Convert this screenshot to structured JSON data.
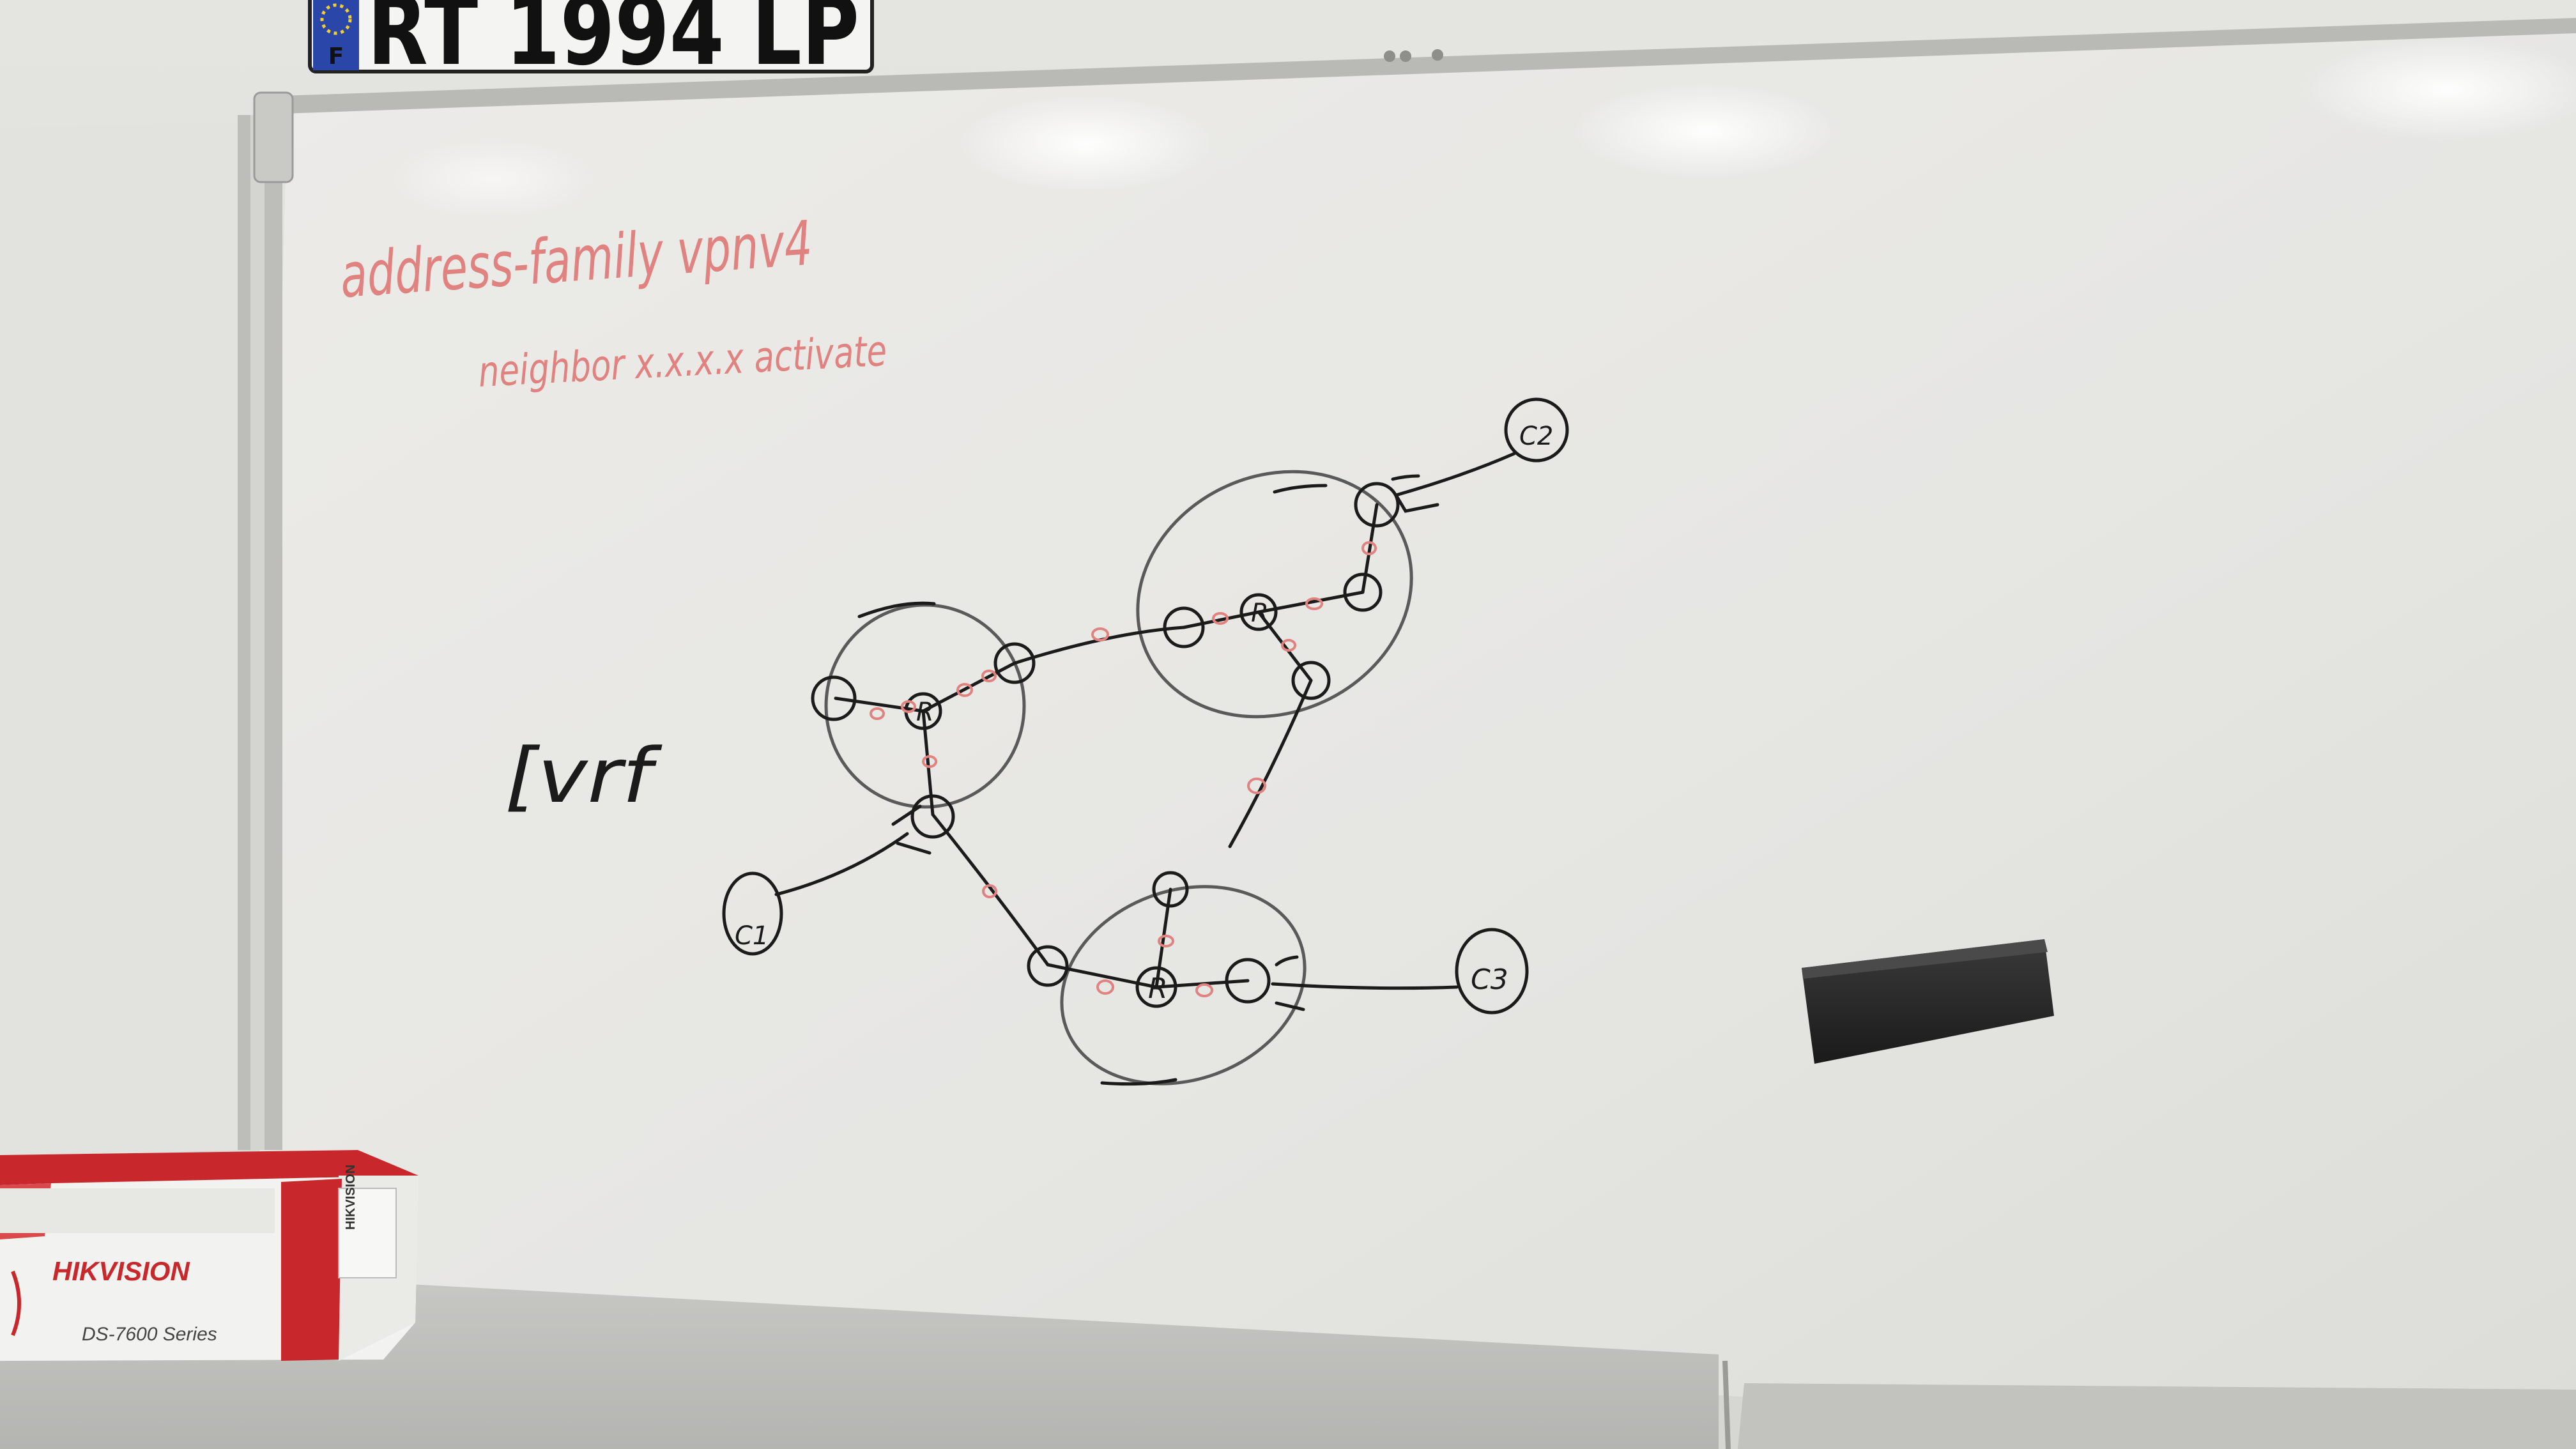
{
  "license_plate": {
    "country_code": "F",
    "text": "RT 1994 LP"
  },
  "whiteboard": {
    "config_line_1": "address-family vpnv4",
    "config_line_2": "neighbor x.x.x.x activate",
    "vrf_label": "[vrf",
    "router_label": "R",
    "ce_labels": [
      "C1",
      "C2",
      "C3"
    ]
  },
  "box": {
    "brand": "HIKVISION",
    "series": "DS-7600 Series",
    "side_brand": "HIKVISION"
  },
  "colors": {
    "board": "#e9e9e6",
    "red_marker": "#e0827f",
    "black_marker": "#1b1b1b",
    "box_red": "#c8282c"
  }
}
